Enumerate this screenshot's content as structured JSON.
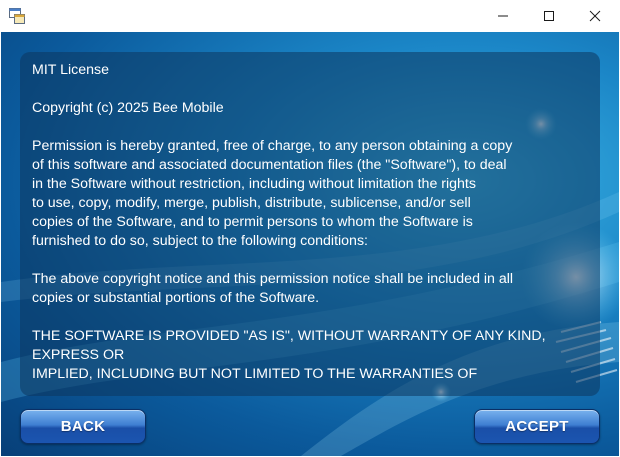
{
  "window": {
    "icons": {
      "app": "app-window-icon",
      "minimize": "minimize-icon",
      "maximize": "maximize-icon",
      "close": "close-icon"
    }
  },
  "license": {
    "text": "MIT License\n\nCopyright (c) 2025 Bee Mobile\n\nPermission is hereby granted, free of charge, to any person obtaining a copy\nof this software and associated documentation files (the \"Software\"), to deal\nin the Software without restriction, including without limitation the rights\nto use, copy, modify, merge, publish, distribute, sublicense, and/or sell\ncopies of the Software, and to permit persons to whom the Software is\nfurnished to do so, subject to the following conditions:\n\nThe above copyright notice and this permission notice shall be included in all\ncopies or substantial portions of the Software.\n\nTHE SOFTWARE IS PROVIDED \"AS IS\", WITHOUT WARRANTY OF ANY KIND,\nEXPRESS OR\nIMPLIED, INCLUDING BUT NOT LIMITED TO THE WARRANTIES OF"
  },
  "buttons": {
    "back_label": "BACK",
    "accept_label": "ACCEPT"
  },
  "colors": {
    "background_dark": "#073f78",
    "background_light": "#3db6e6",
    "button_top": "#7ab2ee",
    "button_bottom": "#1a4fa8"
  }
}
